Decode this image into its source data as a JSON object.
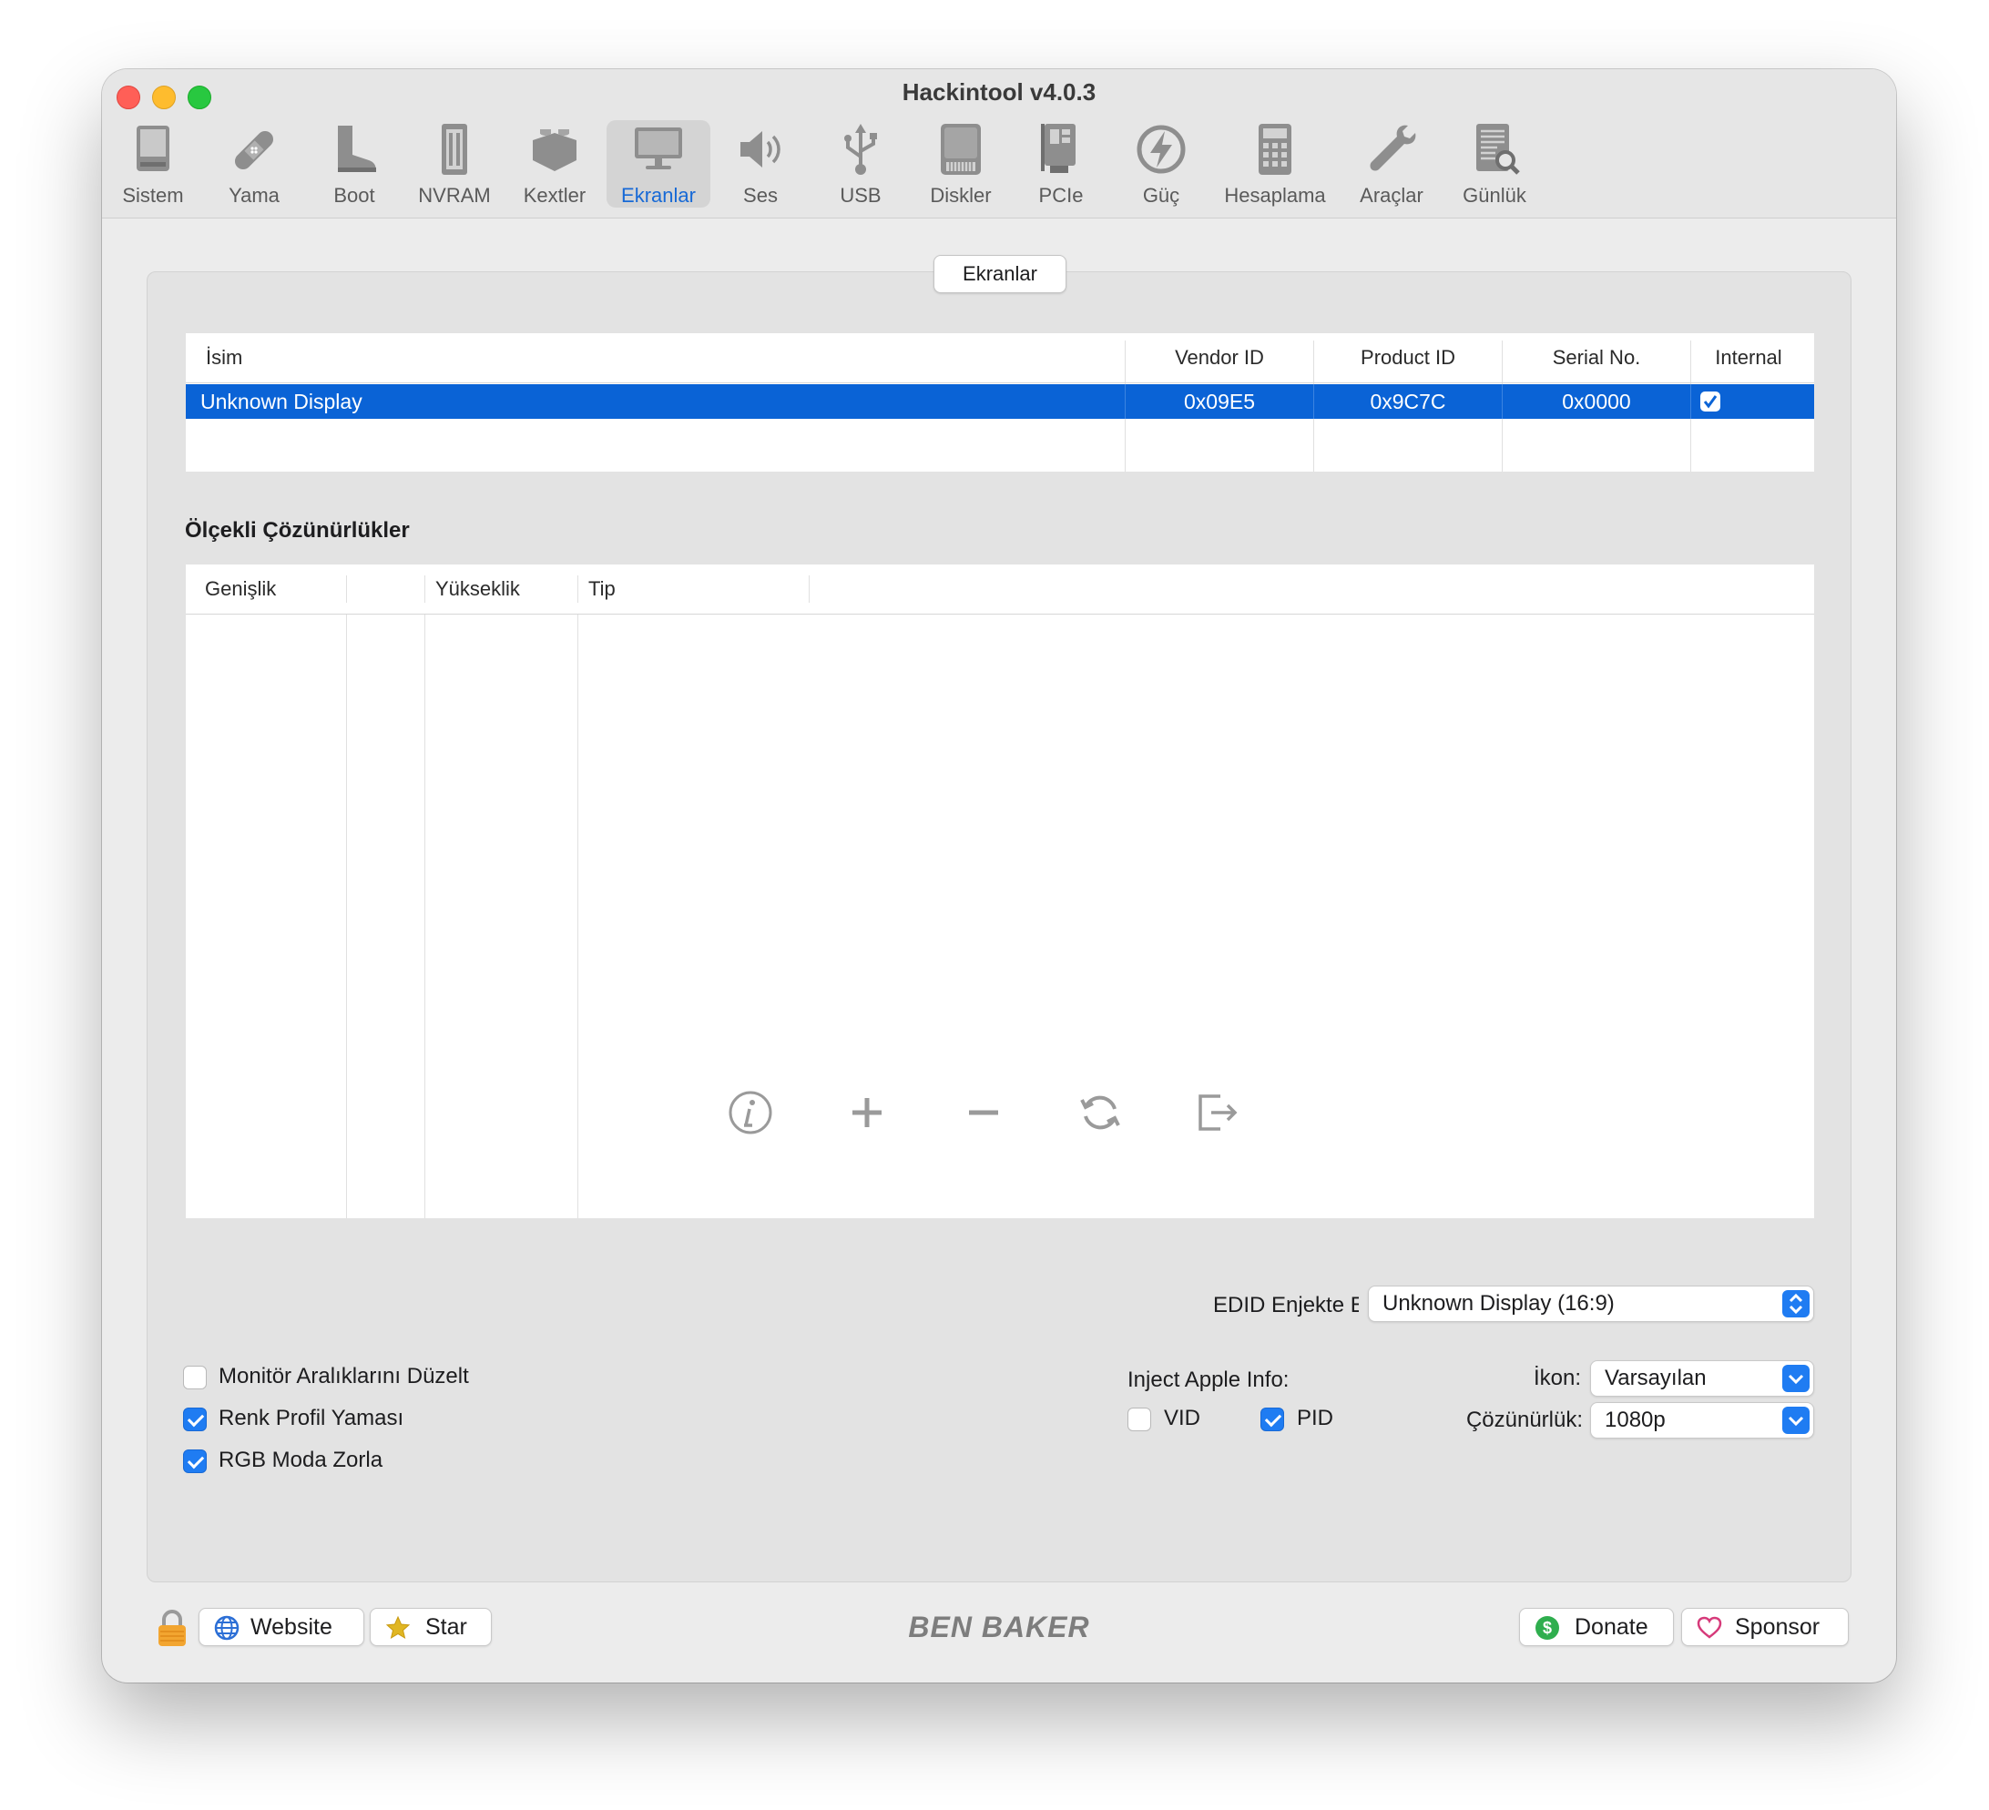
{
  "window": {
    "title": "Hackintool v4.0.3"
  },
  "toolbar": {
    "items": [
      {
        "label": "Sistem",
        "icon": "computer-icon"
      },
      {
        "label": "Yama",
        "icon": "bandage-icon"
      },
      {
        "label": "Boot",
        "icon": "boot-icon"
      },
      {
        "label": "NVRAM",
        "icon": "memory-icon"
      },
      {
        "label": "Kextler",
        "icon": "lego-brick-icon"
      },
      {
        "label": "Ekranlar",
        "icon": "display-icon",
        "active": true
      },
      {
        "label": "Ses",
        "icon": "speaker-icon"
      },
      {
        "label": "USB",
        "icon": "usb-icon"
      },
      {
        "label": "Diskler",
        "icon": "disk-icon"
      },
      {
        "label": "PCIe",
        "icon": "pcie-card-icon"
      },
      {
        "label": "Güç",
        "icon": "power-bolt-icon"
      },
      {
        "label": "Hesaplama",
        "icon": "calculator-icon"
      },
      {
        "label": "Araçlar",
        "icon": "wrench-icon"
      },
      {
        "label": "Günlük",
        "icon": "log-document-icon"
      }
    ]
  },
  "tab": {
    "label": "Ekranlar"
  },
  "displays_table": {
    "headers": {
      "name": "İsim",
      "vendor": "Vendor ID",
      "product": "Product ID",
      "serial": "Serial No.",
      "internal": "Internal"
    },
    "rows": [
      {
        "name": "Unknown Display",
        "vendor": "0x09E5",
        "product": "0x9C7C",
        "serial": "0x0000",
        "internal": true
      }
    ]
  },
  "scaled_resolutions": {
    "title": "Ölçekli Çözünürlükler",
    "headers": {
      "width": "Genişlik",
      "blank": "",
      "height": "Yükseklik",
      "type": "Tip"
    }
  },
  "edid": {
    "label": "EDID Enjekte E",
    "value": "Unknown Display (16:9)"
  },
  "options": {
    "fix_monitor_ranges": {
      "label": "Monitör Aralıklarını Düzelt",
      "checked": false
    },
    "color_profile_patch": {
      "label": "Renk Profil Yaması",
      "checked": true
    },
    "force_rgb_mode": {
      "label": "RGB Moda Zorla",
      "checked": true
    }
  },
  "inject_apple_info": {
    "label": "Inject Apple Info:",
    "vid": {
      "label": "VID",
      "checked": false
    },
    "pid": {
      "label": "PID",
      "checked": true
    }
  },
  "icon_select": {
    "label": "İkon:",
    "value": "Varsayılan"
  },
  "resolution_select": {
    "label": "Çözünürlük:",
    "value": "1080p"
  },
  "actions": [
    "info-icon",
    "add-icon",
    "remove-icon",
    "refresh-icon",
    "export-icon"
  ],
  "footer": {
    "website": "Website",
    "star": "Star",
    "brand": "BEN BAKER",
    "donate": "Donate",
    "sponsor": "Sponsor"
  },
  "colors": {
    "selection": "#0a63d6",
    "accent": "#1f7cf2",
    "active_tab_label": "#1769d6"
  }
}
